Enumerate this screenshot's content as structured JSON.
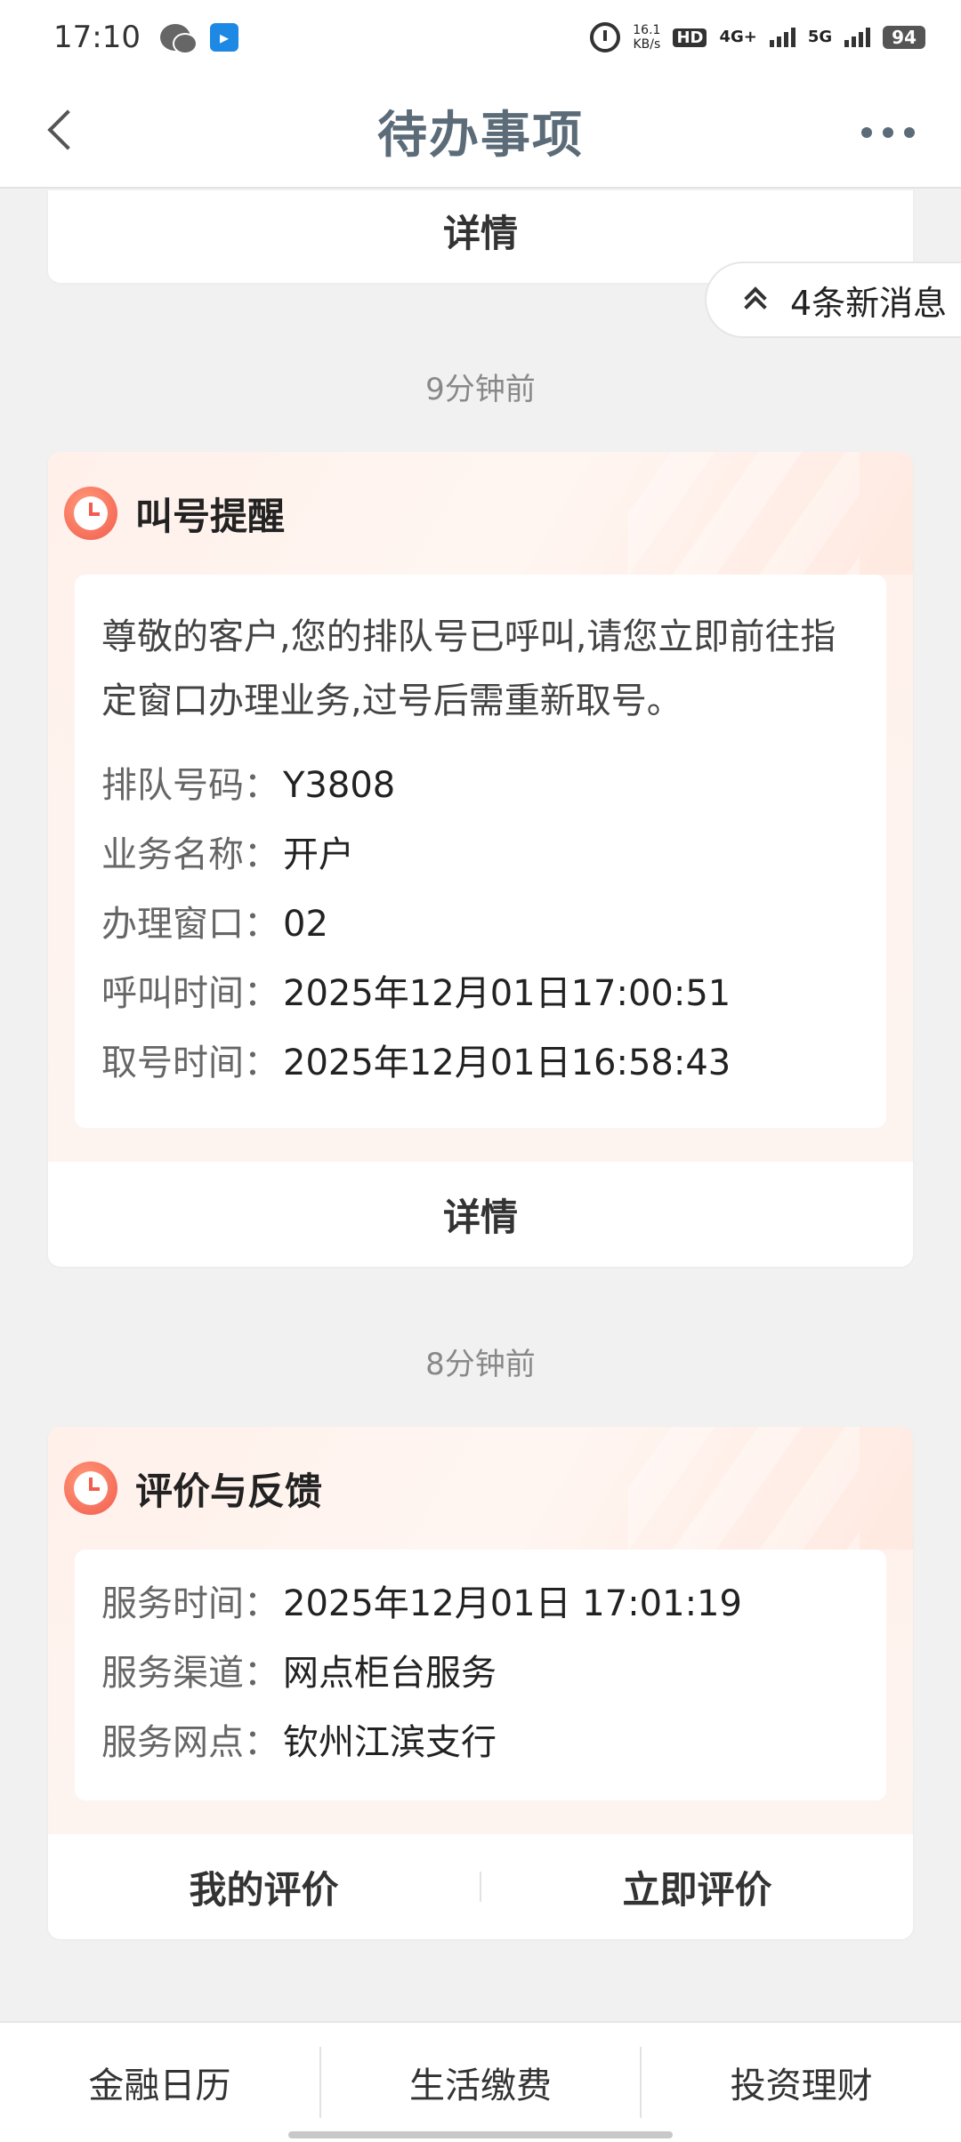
{
  "status_bar": {
    "time": "17:10",
    "speed_value": "16.1",
    "speed_unit": "KB/s",
    "hd": "HD",
    "network_1": "4G+",
    "network_2": "5G",
    "battery": "94"
  },
  "nav": {
    "title": "待办事项"
  },
  "new_messages": {
    "label": "4条新消息"
  },
  "top_partial_card": {
    "detail_label": "详情"
  },
  "section_1": {
    "time_label": "9分钟前",
    "card": {
      "title": "叫号提醒",
      "message": "尊敬的客户,您的排队号已呼叫,请您立即前往指定窗口办理业务,过号后需重新取号。",
      "rows": [
        {
          "label": "排队号码：",
          "value": "Y3808"
        },
        {
          "label": "业务名称：",
          "value": "开户"
        },
        {
          "label": "办理窗口：",
          "value": "02"
        },
        {
          "label": "呼叫时间：",
          "value": "2025年12月01日17:00:51"
        },
        {
          "label": "取号时间：",
          "value": "2025年12月01日16:58:43"
        }
      ],
      "detail_label": "详情"
    }
  },
  "section_2": {
    "time_label": "8分钟前",
    "card": {
      "title": "评价与反馈",
      "rows": [
        {
          "label": "服务时间：",
          "value": "2025年12月01日 17:01:19"
        },
        {
          "label": "服务渠道：",
          "value": "网点柜台服务"
        },
        {
          "label": "服务网点：",
          "value": "钦州江滨支行"
        }
      ],
      "my_review_label": "我的评价",
      "review_now_label": "立即评价"
    }
  },
  "bottom_bar": {
    "items": [
      {
        "label": "金融日历"
      },
      {
        "label": "生活缴费"
      },
      {
        "label": "投资理财"
      }
    ]
  }
}
